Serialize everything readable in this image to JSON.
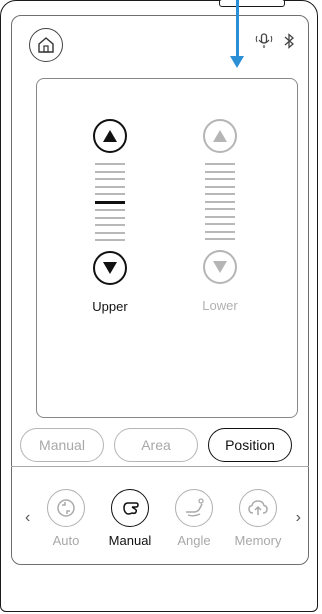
{
  "header": {
    "home_icon": "home-icon",
    "status_icons": [
      "voice-icon",
      "bluetooth-icon"
    ]
  },
  "adjust": {
    "columns": [
      {
        "label": "Upper",
        "active": true,
        "level": 5,
        "steps": 11
      },
      {
        "label": "Lower",
        "active": false,
        "level": 0,
        "steps": 11
      }
    ]
  },
  "segments": {
    "manual": "Manual",
    "area": "Area",
    "position": "Position",
    "selected": "Position"
  },
  "modes": {
    "items": [
      {
        "label": "Auto",
        "icon": "cycle-icon",
        "active": false
      },
      {
        "label": "Manual",
        "icon": "hand-icon",
        "active": true
      },
      {
        "label": "Angle",
        "icon": "angle-icon",
        "active": false
      },
      {
        "label": "Memory",
        "icon": "cloud-icon",
        "active": false
      }
    ],
    "prev": "‹",
    "next": "›"
  },
  "colors": {
    "accent_pointer": "#2b8fd6",
    "active": "#111111",
    "inactive": "#b5b5b5"
  }
}
